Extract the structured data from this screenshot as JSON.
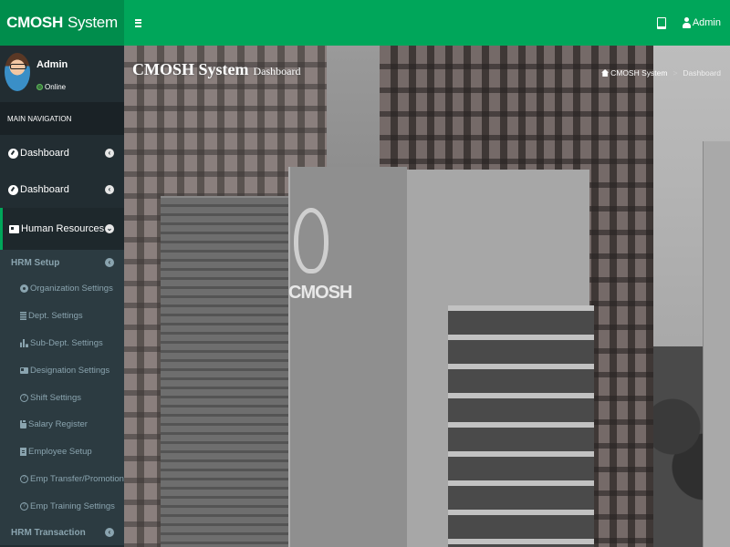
{
  "app": {
    "brand_bold": "CMOSH",
    "brand_rest": "System"
  },
  "navbar": {
    "user_label": "Admin",
    "icons": [
      "bars-icon",
      "tablet-icon",
      "user-icon"
    ]
  },
  "sidebar": {
    "user": {
      "name": "Admin",
      "status": "Online"
    },
    "nav_header": "MAIN NAVIGATION",
    "items": [
      {
        "label": "Dashboard",
        "icon": "dashboard-icon"
      },
      {
        "label": "Dashboard",
        "icon": "dashboard-icon"
      },
      {
        "label": "Human Resources",
        "icon": "id-card-icon",
        "active": true
      }
    ],
    "hrm_setup": {
      "label": "HRM Setup",
      "items": [
        {
          "label": "Organization Settings",
          "icon": "gear-icon"
        },
        {
          "label": "Dept. Settings",
          "icon": "building-icon"
        },
        {
          "label": "Sub-Dept. Settings",
          "icon": "bar-chart-icon"
        },
        {
          "label": "Designation Settings",
          "icon": "id-card-icon"
        },
        {
          "label": "Shift Settings",
          "icon": "question-icon"
        },
        {
          "label": "Salary Register",
          "icon": "clipboard-icon"
        },
        {
          "label": "Employee Setup",
          "icon": "file-icon"
        },
        {
          "label": "Emp Transfer/Promotion",
          "icon": "question-icon"
        },
        {
          "label": "Emp Training Settings",
          "icon": "question-icon"
        }
      ]
    },
    "hrm_transaction": {
      "label": "HRM Transaction"
    }
  },
  "content": {
    "title": "CMOSH System",
    "subtitle": "Dashboard",
    "breadcrumb": [
      "CMOSH System",
      "Dashboard"
    ],
    "building_sign": "CMOSH"
  },
  "colors": {
    "header_green": "#00a65a",
    "logo_green": "#008d4c",
    "sidebar_bg": "#222d32",
    "submenu_bg": "#2c3b41",
    "submenu_text": "#8aa4af"
  }
}
